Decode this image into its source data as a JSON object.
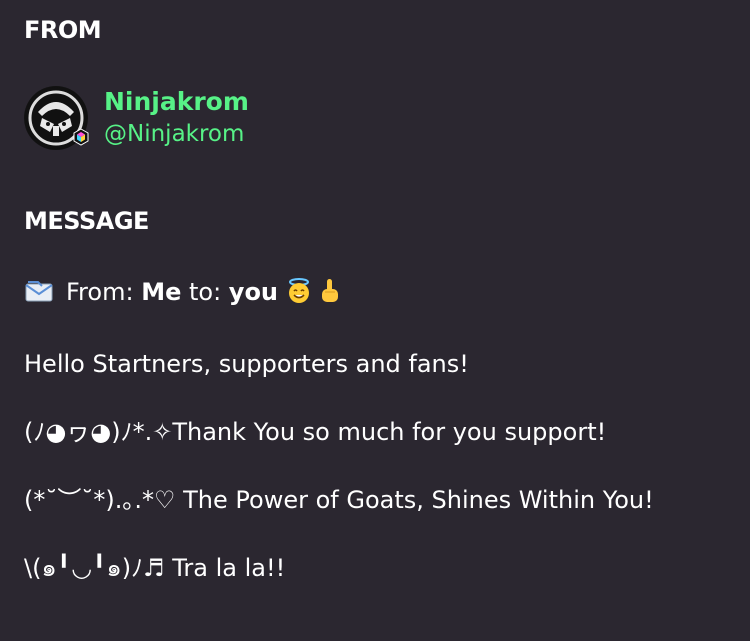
{
  "from": {
    "heading": "FROM",
    "display_name": "Ninjakrom",
    "handle": "@Ninjakrom"
  },
  "message": {
    "heading": "MESSAGE",
    "line1": {
      "prefix": "From: ",
      "sender": "Me",
      "middle": " to: ",
      "recipient": "you"
    },
    "line2": "Hello Startners, supporters and fans!",
    "line3": "(ﾉ◕ヮ◕)ﾉ*.✧Thank You so much for you support!",
    "line4": "(*˘︶˘*).｡.*♡ The Power of Goats, Shines Within You!",
    "line5": "\\(๑╹◡╹๑)ﾉ♬ Tra la la!!"
  },
  "colors": {
    "background": "#2b2730",
    "accent_green": "#57f287",
    "text": "#ffffff"
  },
  "icons": [
    "avatar-image",
    "envelope-icon",
    "smiling-halo-icon",
    "pointing-up-icon"
  ]
}
